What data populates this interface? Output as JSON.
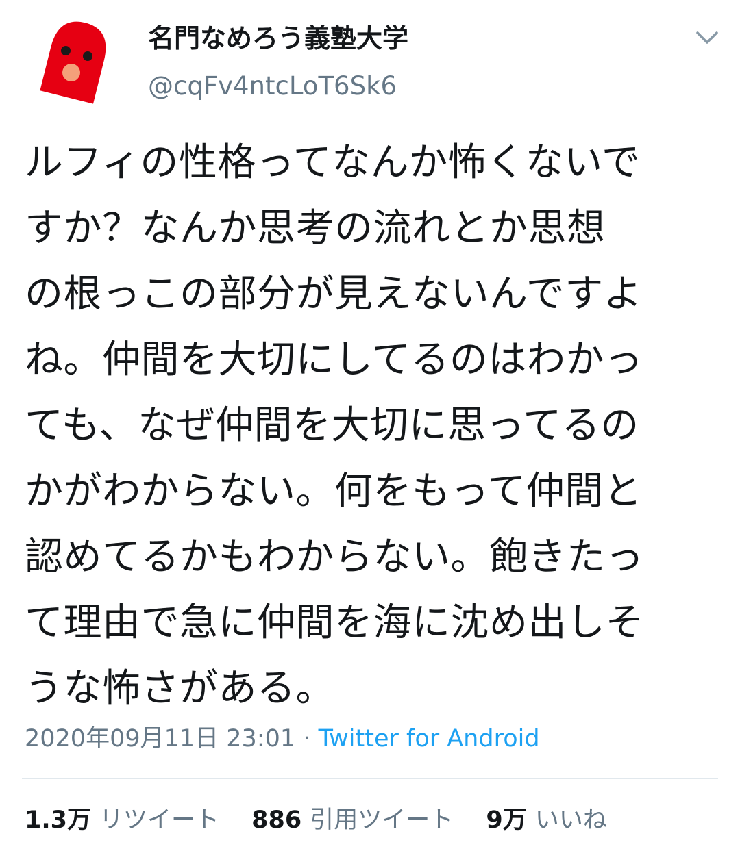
{
  "user": {
    "display_name": "名門なめろう義塾大学",
    "handle": "@cqFv4ntcLoT6Sk6"
  },
  "tweet": {
    "lines": [
      "ルフィの性格ってなんか怖くないで",
      "すか？なんか思考の流れとか思想",
      "の根っこの部分が見えないんですよ",
      "ね。仲間を大切にしてるのはわかっ",
      "ても、なぜ仲間を大切に思ってるの",
      "かがわからない。何をもって仲間と",
      "認めてるかもわからない。飽きたっ",
      "て理由で急に仲間を海に沈め出しそ",
      "うな怖さがある。"
    ],
    "timestamp": "2020年09月11日 23:01",
    "separator": "·",
    "source": "Twitter for Android"
  },
  "stats": {
    "retweets_count": "1.3万",
    "retweets_label": "リツイート",
    "quotes_count": "886",
    "quotes_label": "引用ツイート",
    "likes_count": "9万",
    "likes_label": "いいね"
  },
  "icons": {
    "avatar": "red-mascot-avatar",
    "menu": "chevron-down-icon"
  },
  "colors": {
    "text_primary": "#14171a",
    "text_secondary": "#657786",
    "link": "#1da1f2",
    "divider": "#e1e8ed",
    "avatar_red": "#e60012"
  }
}
